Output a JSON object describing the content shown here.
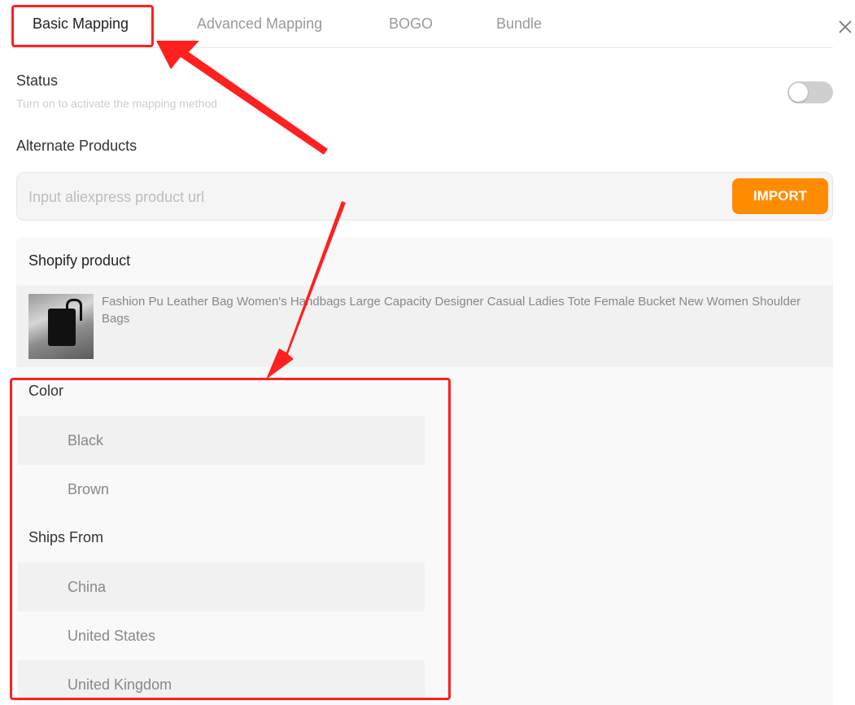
{
  "tabs": [
    {
      "label": "Basic Mapping"
    },
    {
      "label": "Advanced Mapping"
    },
    {
      "label": "BOGO"
    },
    {
      "label": "Bundle"
    }
  ],
  "status": {
    "title": "Status",
    "description": "Turn on to activate the mapping method",
    "enabled": false
  },
  "alternate": {
    "title": "Alternate Products",
    "placeholder": "Input aliexpress product url",
    "import_label": "IMPORT"
  },
  "shopify": {
    "title": "Shopify product",
    "product_name": "Fashion Pu Leather Bag Women's Handbags Large Capacity Designer Casual Ladies Tote Female Bucket New Women Shoulder Bags"
  },
  "options": {
    "color_title": "Color",
    "colors": [
      "Black",
      "Brown"
    ],
    "ships_title": "Ships From",
    "ships": [
      "China",
      "United States",
      "United Kingdom"
    ]
  },
  "colors": {
    "accent": "#ff8c00",
    "annotation": "#ff2020"
  }
}
